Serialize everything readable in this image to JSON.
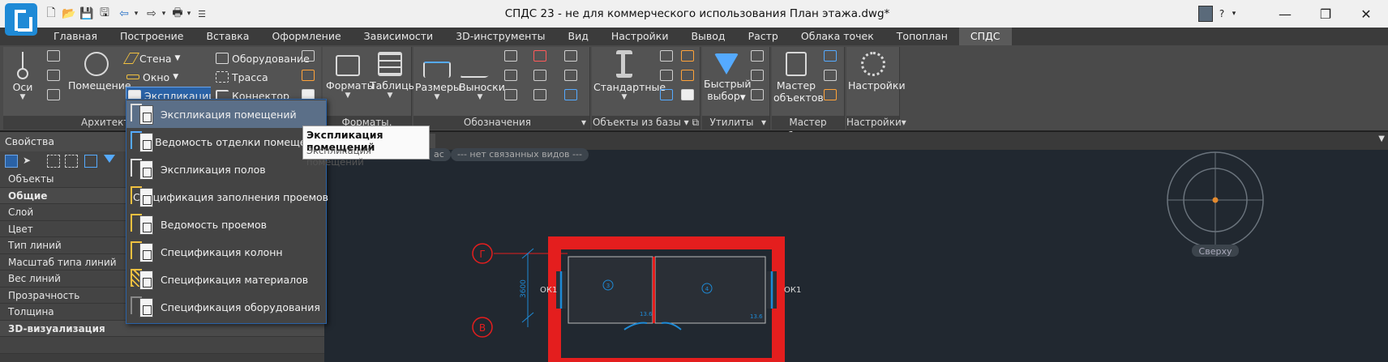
{
  "window": {
    "title": "СПДС 23 - не для коммерческого использования План этажа.dwg*",
    "help_label": "?"
  },
  "menu_tabs": [
    "Главная",
    "Построение",
    "Вставка",
    "Оформление",
    "Зависимости",
    "3D-инструменты",
    "Вид",
    "Настройки",
    "Вывод",
    "Растр",
    "Облака точек",
    "Топоплан",
    "СПДС"
  ],
  "active_tab": "СПДС",
  "ribbon": {
    "arch": {
      "axes": "Оси",
      "room": "Помещение",
      "wall": "Стена",
      "window": "Окно",
      "explication": "Экспликации",
      "label": "Архитектура"
    },
    "engineering": {
      "equipment": "Оборудование",
      "route": "Трасса",
      "connector": "Коннектор"
    },
    "formats": {
      "formats": "Форматы",
      "tables": "Таблицы",
      "label": "Форматы, таблицы"
    },
    "notations": {
      "sizes": "Размеры",
      "leaders": "Выноски",
      "label": "Обозначения"
    },
    "db": {
      "standard": "Стандартные",
      "label": "Объекты из базы"
    },
    "utils": {
      "quick_select_1": "Быстрый",
      "quick_select_2": "выбор",
      "label": "Утилиты"
    },
    "master": {
      "master_1": "Мастер",
      "master_2": "объектов",
      "label": "Мастер объектов"
    },
    "settings": {
      "settings": "Настройки",
      "label": "Настройки"
    }
  },
  "properties": {
    "title": "Свойства",
    "rows": [
      {
        "label": "Объекты",
        "header": false
      },
      {
        "label": "Общие",
        "header": true
      },
      {
        "label": "Слой",
        "header": false
      },
      {
        "label": "Цвет",
        "header": false
      },
      {
        "label": "Тип линий",
        "header": false
      },
      {
        "label": "Масштаб типа линий",
        "header": false
      },
      {
        "label": "Вес линий",
        "header": false
      },
      {
        "label": "Прозрачность",
        "header": false
      },
      {
        "label": "Толщина",
        "header": false
      },
      {
        "label": "3D-визуализация",
        "header": true
      }
    ]
  },
  "dropdown": {
    "items": [
      "Экспликация помещений",
      "Ведомость отделки помещений",
      "Экспликация полов",
      "Спецификация заполнения проемов",
      "Ведомость проемов",
      "Спецификация колонн",
      "Спецификация материалов",
      "Спецификация оборудования"
    ]
  },
  "tooltip": {
    "title": "Экспликация помещений",
    "description": "Экспликация помещений"
  },
  "drawing": {
    "viewtags": [
      "ас",
      "--- нет связанных видов ---"
    ],
    "viewcube_label": "Сверху",
    "axes": [
      "Г",
      "В"
    ],
    "dimension": "3600",
    "window_marks": [
      "ОК1",
      "ОК1"
    ],
    "room_numbers": [
      "3",
      "4"
    ],
    "area_labels": [
      "13.6",
      "13.6"
    ]
  },
  "colors": {
    "accent": "#2a62a6",
    "wall_red": "#e41e1e",
    "dim_blue": "#1e8ad6"
  }
}
